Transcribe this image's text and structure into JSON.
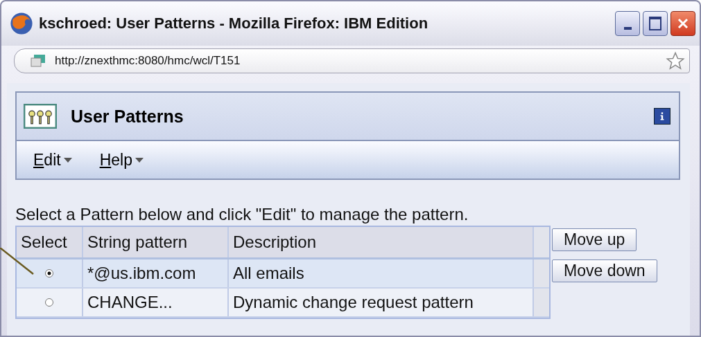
{
  "window": {
    "title": "kschroed: User Patterns - Mozilla Firefox: IBM Edition"
  },
  "address_bar": {
    "url": "http://znexthmc:8080/hmc/wcl/T151"
  },
  "panel": {
    "title": "User Patterns"
  },
  "menus": [
    {
      "label": "Edit"
    },
    {
      "label": "Help"
    }
  ],
  "instruction": "Select a Pattern below and click \"Edit\" to manage the pattern.",
  "table": {
    "columns": [
      "Select",
      "String pattern",
      "Description"
    ],
    "rows": [
      {
        "selected": true,
        "pattern": "*@us.ibm.com",
        "description": "All emails"
      },
      {
        "selected": false,
        "pattern": "CHANGE...",
        "description": "Dynamic change request pattern"
      }
    ]
  },
  "buttons": [
    {
      "label": "Move up"
    },
    {
      "label": "Move down"
    }
  ]
}
